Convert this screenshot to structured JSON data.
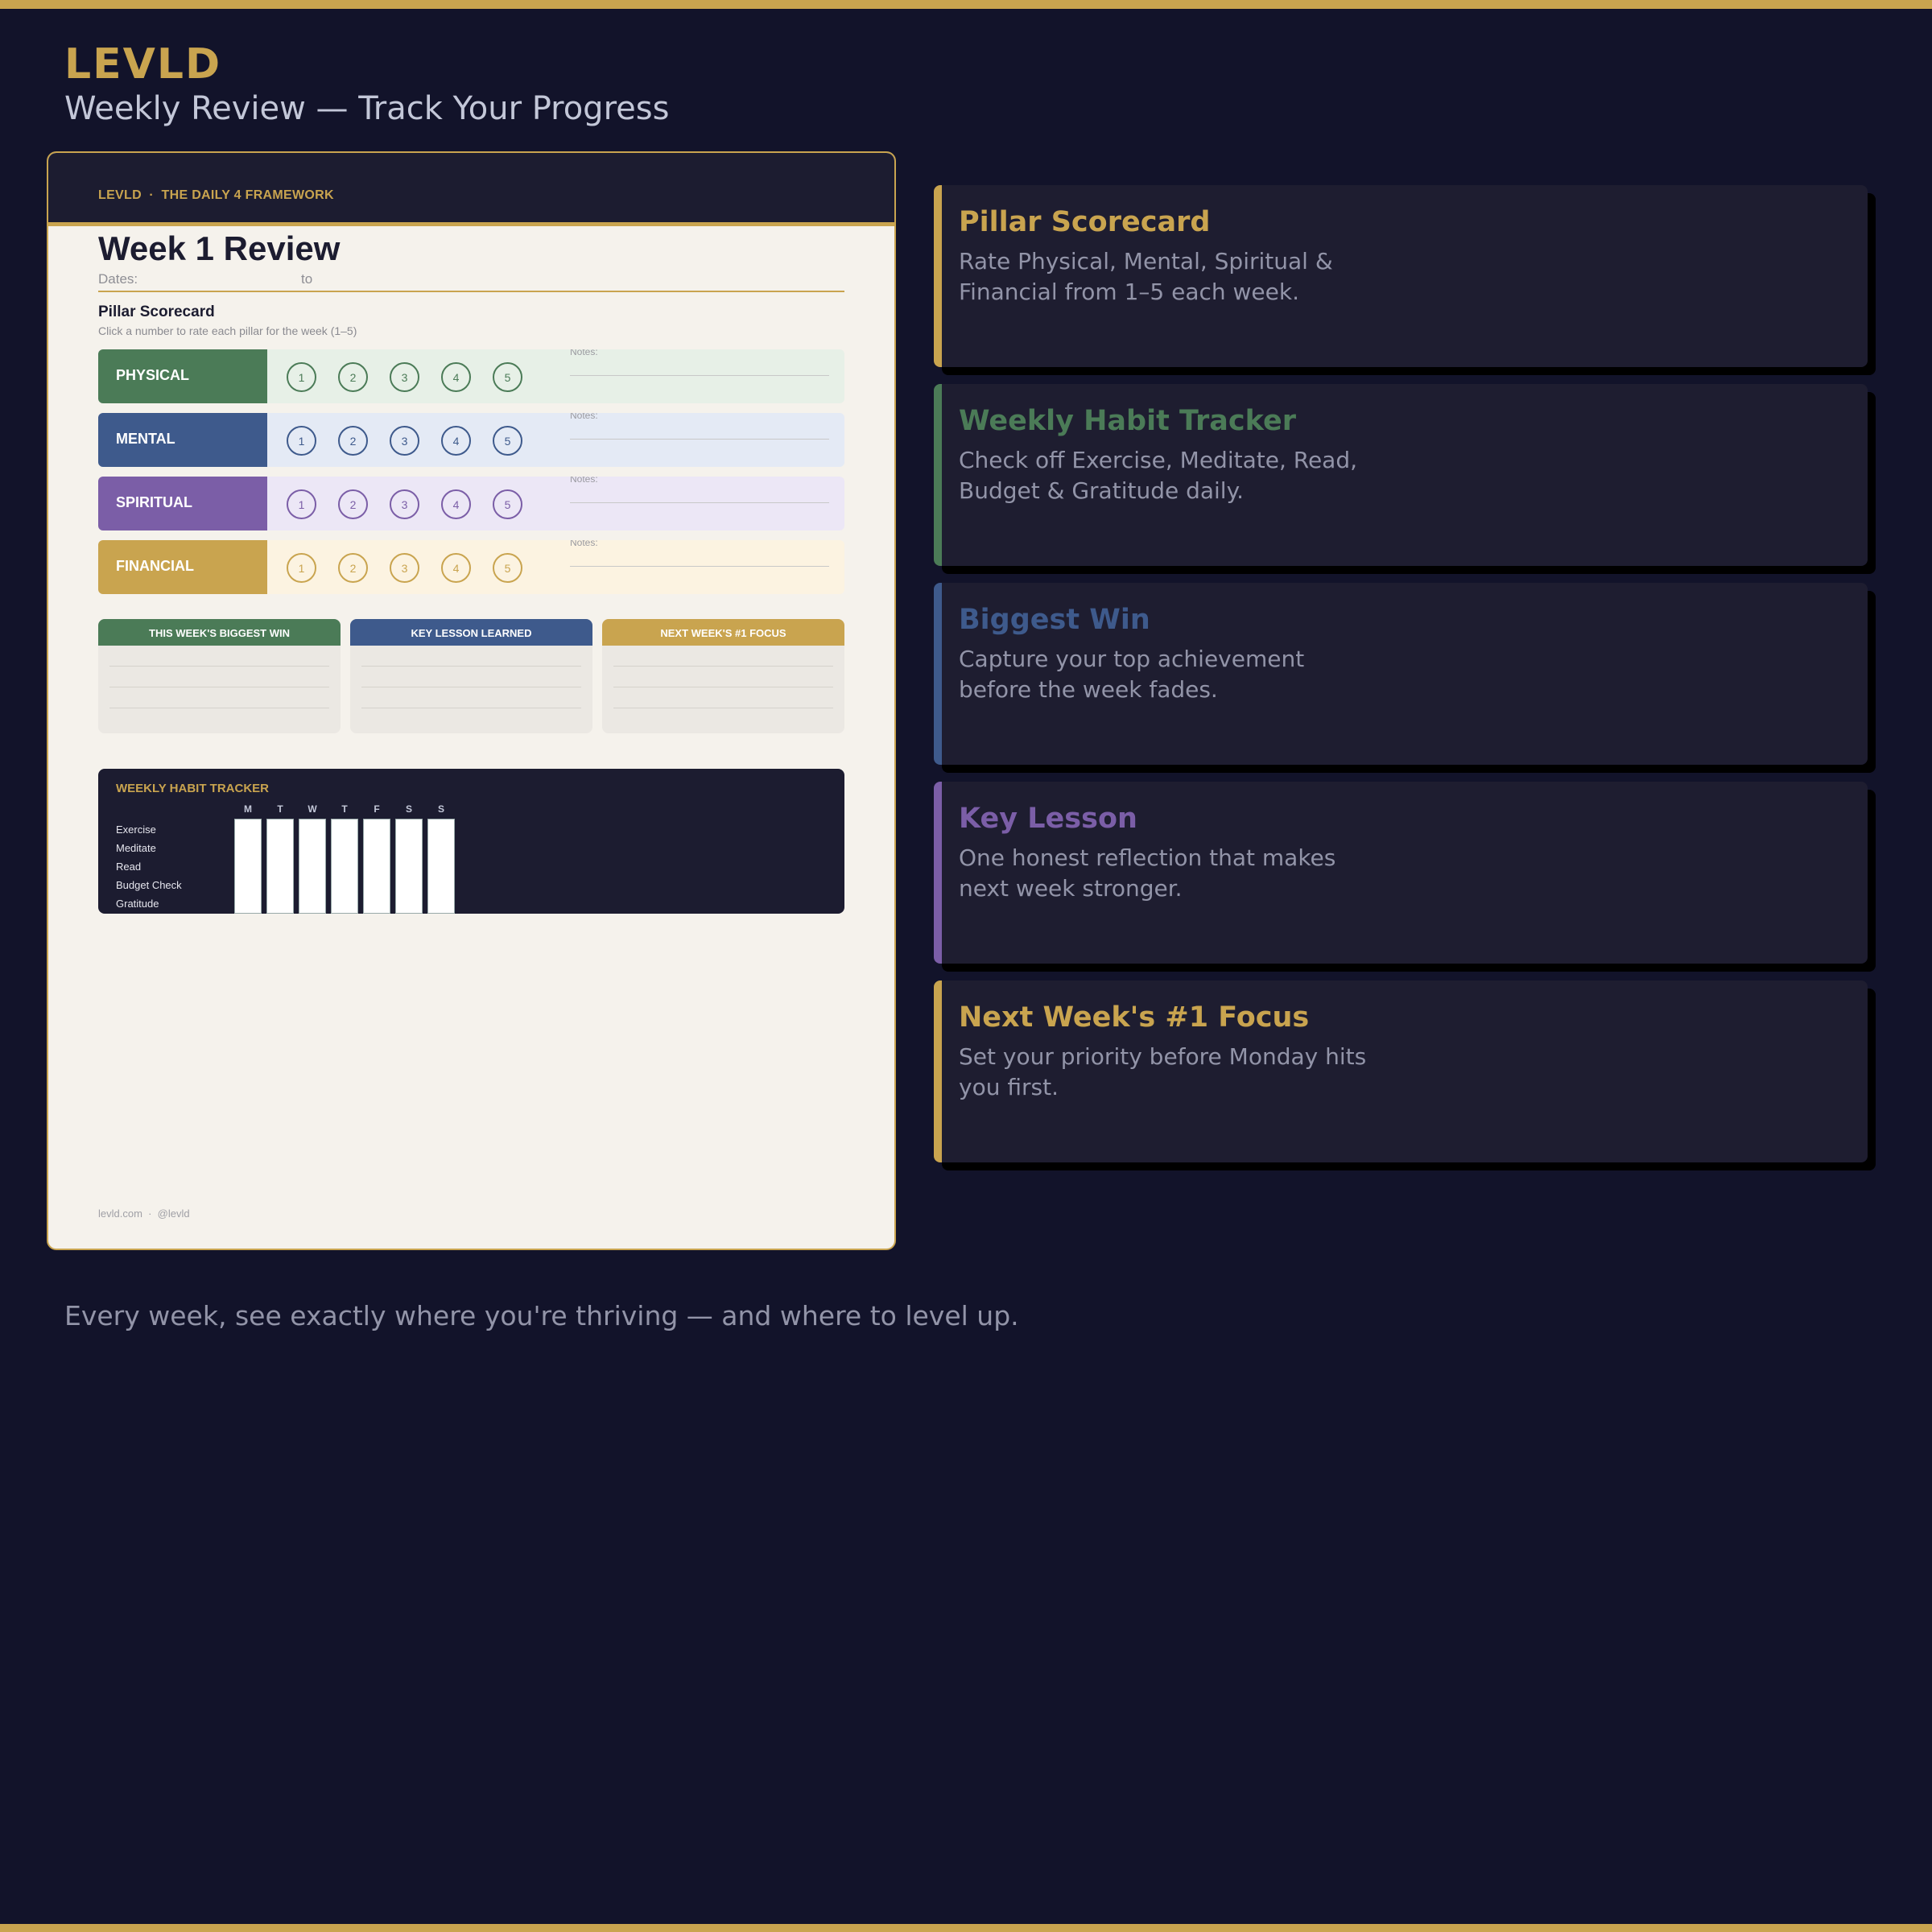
{
  "header": {
    "brand": "LEVLD",
    "subtitle": "Weekly Review — Track Your Progress"
  },
  "colors": {
    "gold": "#c9a44f",
    "green": "#4b7b57",
    "blue": "#3e5a8c",
    "purple": "#7b5ea7",
    "background": "#12132a"
  },
  "document": {
    "header_text": "LEVLD  ·  THE DAILY 4 FRAMEWORK",
    "title": "Week 1 Review",
    "dates_label": "Dates:",
    "dates_to": "to",
    "scorecard_title": "Pillar Scorecard",
    "scorecard_subtitle": "Click a number to rate each pillar for the week (1–5)",
    "notes_label": "Notes:",
    "pillars": [
      {
        "label": "PHYSICAL",
        "color": "#4b7b57",
        "tint": "#e7f0e7"
      },
      {
        "label": "MENTAL",
        "color": "#3e5a8c",
        "tint": "#e4eaf5"
      },
      {
        "label": "SPIRITUAL",
        "color": "#7b5ea7",
        "tint": "#ece7f6"
      },
      {
        "label": "FINANCIAL",
        "color": "#c9a44f",
        "tint": "#fcf3e1"
      }
    ],
    "ratings": [
      "1",
      "2",
      "3",
      "4",
      "5"
    ],
    "boxes": [
      {
        "title": "THIS WEEK'S BIGGEST WIN",
        "color": "#4b7b57"
      },
      {
        "title": "KEY LESSON LEARNED",
        "color": "#3e5a8c"
      },
      {
        "title": "NEXT WEEK'S #1 FOCUS",
        "color": "#c9a44f"
      }
    ],
    "tracker": {
      "title": "WEEKLY HABIT TRACKER",
      "days": [
        "M",
        "T",
        "W",
        "T",
        "F",
        "S",
        "S"
      ],
      "habits": [
        "Exercise",
        "Meditate",
        "Read",
        "Budget Check",
        "Gratitude"
      ]
    },
    "footer": "levld.com  ·  @levld"
  },
  "features": [
    {
      "title": "Pillar Scorecard",
      "desc": "Rate Physical, Mental, Spiritual & Financial from 1–5 each week.",
      "color": "#c9a44f"
    },
    {
      "title": "Weekly Habit Tracker",
      "desc": "Check off Exercise, Meditate, Read, Budget & Gratitude daily.",
      "color": "#4b7b57"
    },
    {
      "title": "Biggest Win",
      "desc": "Capture your top achievement before the week fades.",
      "color": "#3e5a8c"
    },
    {
      "title": "Key Lesson",
      "desc": "One honest reflection that makes next week stronger.",
      "color": "#7b5ea7"
    },
    {
      "title": "Next Week's #1 Focus",
      "desc": "Set your priority before Monday hits you first.",
      "color": "#c9a44f"
    }
  ],
  "tagline": "Every week, see exactly where you're thriving — and where to level up."
}
